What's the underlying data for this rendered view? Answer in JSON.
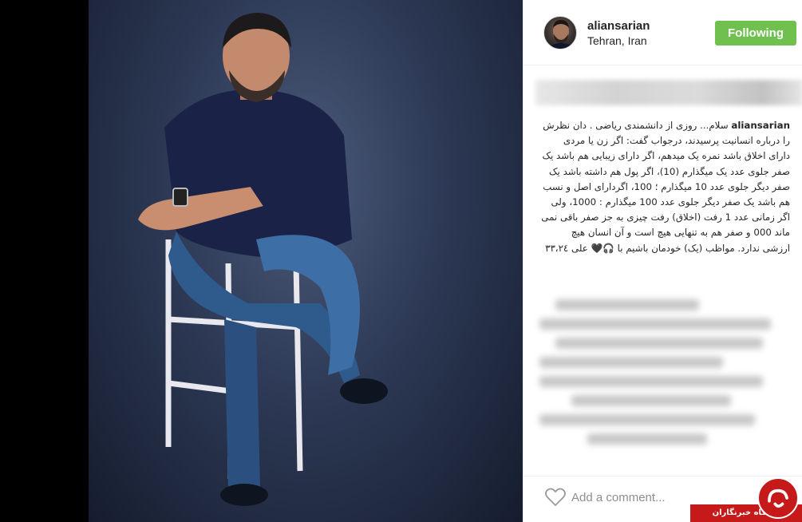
{
  "post": {
    "username": "aliansarian",
    "location": "Tehran, Iran",
    "follow_label": "Following",
    "caption_user": "aliansarian",
    "caption_text": "سلام... روزی از دانشمندی ریاضی . دان نظرش را درباره انسانیت پرسیدند، درجواب گفت: اگر زن یا مردی دارای اخلاق باشد نمره یک میدهم، اگر دارای زیبایی هم باشد یک صفر جلوی عدد یک میگذارم (10)، اگر پول هم داشته باشد یک صفر دیگر جلوی عدد 10 میگذارم ؛ 100، اگردارای اصل و نسب هم باشد یک صفر دیگر جلوی عدد 100 میگذارم : 1000، ولی اگر زمانی عدد 1 رفت (اخلاق) رفت چیزی به جز صفر باقی نمی ماند 000 و صفر هم به تنهایی هیچ است و آن انسان هیچ ارزشی ندارد. مواظب (یک) خودمان باشیم با 🎧🖤 علی ٣٣،٢٤",
    "comment_placeholder": "Add a comment..."
  },
  "watermark": {
    "label": "باشگاه خبرنگاران"
  },
  "colors": {
    "follow_green": "#70c050",
    "watermark_red": "#c61a1a"
  },
  "icons": [
    "heart-icon",
    "avatar",
    "watermark-logo"
  ]
}
